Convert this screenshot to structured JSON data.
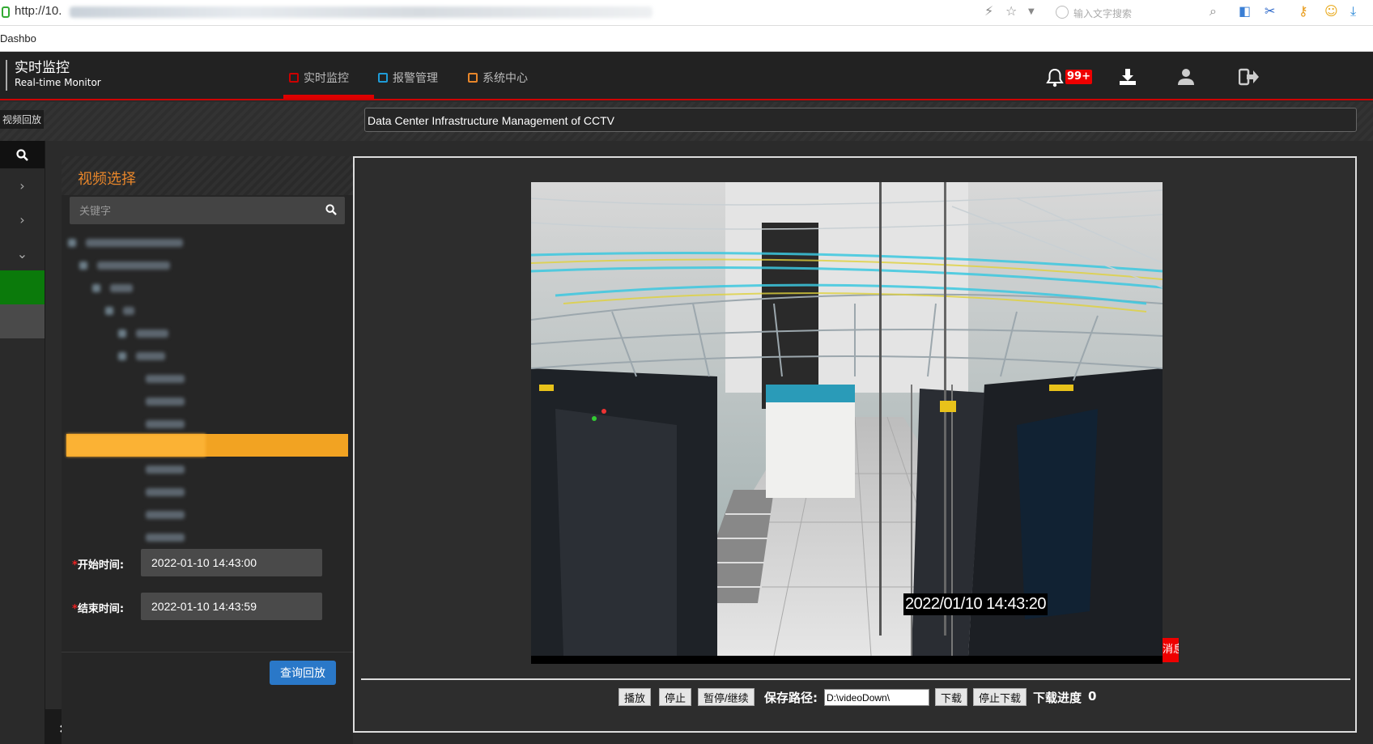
{
  "browser": {
    "url_visible": "http://10.",
    "search_placeholder": "输入文字搜索",
    "tab_title": "Dashbo"
  },
  "header": {
    "brand_cn": "实时监控",
    "brand_en": "Real-time Monitor",
    "nav": [
      {
        "label": "实时监控",
        "color": "#cc0000",
        "active": true
      },
      {
        "label": "报警管理",
        "color": "#1e9bd7",
        "active": false
      },
      {
        "label": "系统中心",
        "color": "#e8862a",
        "active": false
      }
    ],
    "alert_badge": "99+",
    "icons": [
      "bell-icon",
      "download-icon",
      "user-icon",
      "logout-icon"
    ]
  },
  "subbar": {
    "breadcrumb": "视频回放",
    "system_title": "Data Center Infrastructure Management of CCTV"
  },
  "panel": {
    "title": "视频选择",
    "search_placeholder": "关键字",
    "start_label": "开始时间:",
    "start_value": "2022-01-10 14:43:00",
    "end_label": "结束时间:",
    "end_value": "2022-01-10 14:43:59",
    "query_button": "查询回放"
  },
  "video": {
    "osd_timestamp": "2022/01/10  14:43:20",
    "message_tag": "消息"
  },
  "controls": {
    "play": "播放",
    "stop": "停止",
    "pause_resume": "暂停/继续",
    "save_path_label": "保存路径:",
    "save_path_value": "D:\\videoDown\\",
    "download": "下载",
    "stop_download": "停止下载",
    "progress_label": "下载进度",
    "progress_value": "0"
  },
  "colors": {
    "accent_red": "#cc0000",
    "accent_orange": "#e8862a",
    "selected_row": "#f2a322",
    "button_blue": "#2a78c8"
  }
}
